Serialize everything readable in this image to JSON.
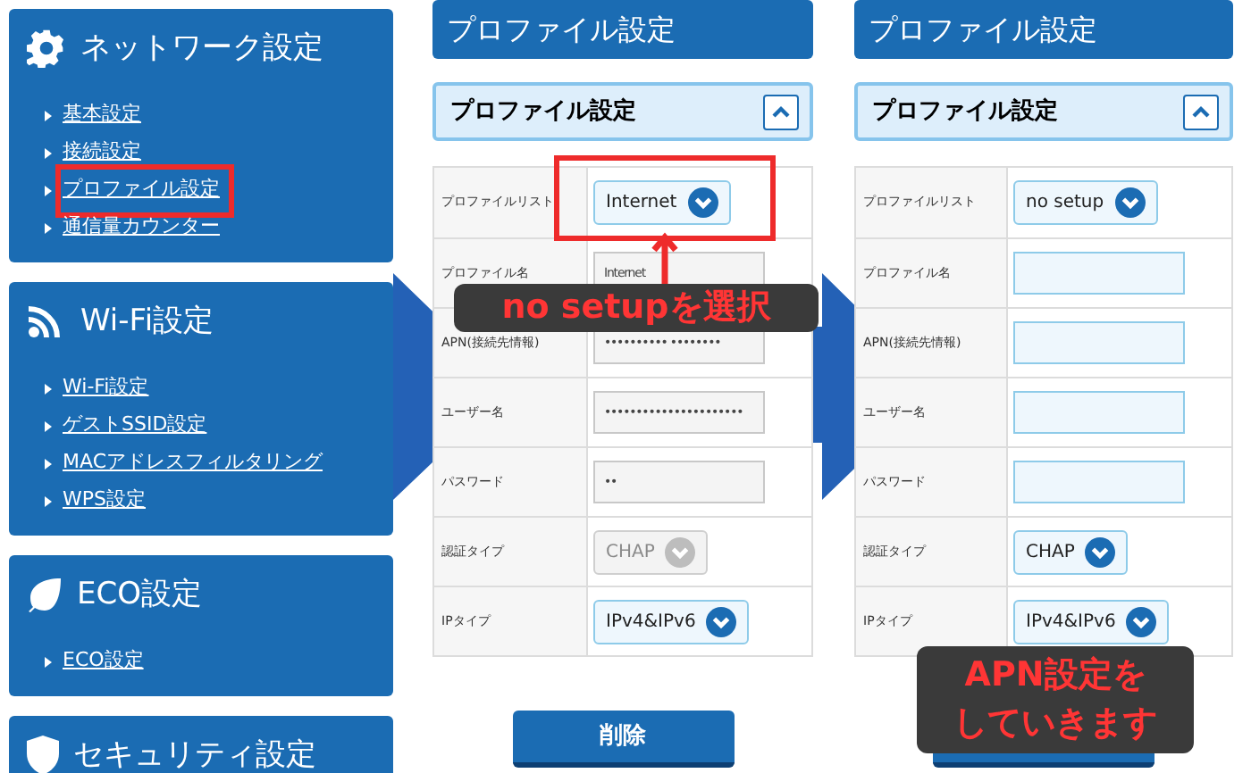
{
  "sidebar": {
    "sections": [
      {
        "kind": "network",
        "title": "ネットワーク設定",
        "items": [
          {
            "label": "基本設定",
            "annotated": false
          },
          {
            "label": "接続設定",
            "annotated": false
          },
          {
            "label": "プロファイル設定",
            "annotated": true
          },
          {
            "label": "通信量カウンター",
            "annotated": false
          }
        ]
      },
      {
        "kind": "wifi",
        "title": "Wi-Fi設定",
        "items": [
          {
            "label": "Wi-Fi設定",
            "annotated": false
          },
          {
            "label": "ゲストSSID設定",
            "annotated": false
          },
          {
            "label": "MACアドレスフィルタリング",
            "annotated": false
          },
          {
            "label": "WPS設定",
            "annotated": false
          }
        ]
      },
      {
        "kind": "eco",
        "title": "ECO設定",
        "items": [
          {
            "label": "ECO設定",
            "annotated": false
          }
        ]
      },
      {
        "kind": "security",
        "title": "セキュリティ設定"
      }
    ]
  },
  "panels": [
    {
      "header": "プロファイル設定",
      "section_title": "プロファイル設定",
      "expanded": true,
      "rows": [
        {
          "label": "プロファイルリスト",
          "kind": "select",
          "value": "Internet",
          "disabled": false,
          "annotated": true
        },
        {
          "label": "プロファイル名",
          "kind": "input",
          "value": "Internet",
          "disabled": true
        },
        {
          "label": "APN(接続先情報)",
          "kind": "input",
          "value": "•••••••••• ••••••••",
          "disabled": true
        },
        {
          "label": "ユーザー名",
          "kind": "input",
          "value": "••••••••••••••••••••••",
          "disabled": true
        },
        {
          "label": "パスワード",
          "kind": "input",
          "value": "••",
          "disabled": true
        },
        {
          "label": "認証タイプ",
          "kind": "select",
          "value": "CHAP",
          "disabled": true,
          "annotated": false
        },
        {
          "label": "IPタイプ",
          "kind": "select",
          "value": "IPv4&IPv6",
          "disabled": false,
          "annotated": false
        }
      ],
      "delete_button": "削除"
    },
    {
      "header": "プロファイル設定",
      "section_title": "プロファイル設定",
      "expanded": true,
      "rows": [
        {
          "label": "プロファイルリスト",
          "kind": "select",
          "value": "no setup",
          "disabled": false,
          "annotated": false
        },
        {
          "label": "プロファイル名",
          "kind": "input",
          "disabled": false
        },
        {
          "label": "APN(接続先情報)",
          "kind": "input",
          "disabled": false
        },
        {
          "label": "ユーザー名",
          "kind": "input",
          "disabled": false
        },
        {
          "label": "パスワード",
          "kind": "input",
          "disabled": false
        },
        {
          "label": "認証タイプ",
          "kind": "select",
          "value": "CHAP",
          "disabled": false,
          "annotated": false
        },
        {
          "label": "IPタイプ",
          "kind": "select",
          "value": "IPv4&IPv6",
          "disabled": false,
          "annotated": false
        }
      ]
    }
  ],
  "callouts": [
    {
      "lines": [
        "no setupを選択"
      ]
    },
    {
      "lines": [
        "APN設定を",
        "していきます"
      ]
    }
  ]
}
